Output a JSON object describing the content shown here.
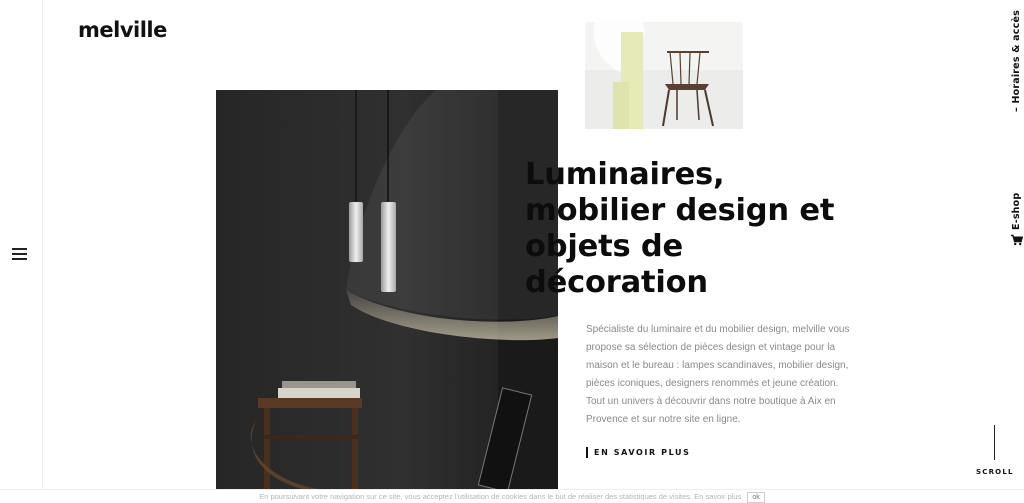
{
  "brand": {
    "logo_text": "melville"
  },
  "nav": {
    "menu_icon": "hamburger-menu-icon"
  },
  "side_links": {
    "hours": "– Horaires & accès",
    "eshop": "E-shop",
    "eshop_icon": "shopping-cart-icon"
  },
  "hero": {
    "headline_lines": [
      "Luminaires,",
      "mobilier design et",
      "objets de",
      "décoration"
    ],
    "description": "Spécialiste du luminaire et du mobilier design, melville vous propose sa sélection de pièces design et vintage pour la maison et le bureau : lampes scandinaves, mobilier design, pièces iconiques, designers renommés et jeune création. Tout un univers à découvrir dans notre boutique à Aix en Provence et sur notre site en ligne.",
    "cta": "EN SAVOIR PLUS"
  },
  "scroll": {
    "label": "SCROLL"
  },
  "cookie": {
    "text": "En poursuivant votre navigation sur ce site, vous acceptez l'utilisation de cookies dans le but de réaliser des statistiques de visites.",
    "link": "En savoir plus",
    "ok": "ok"
  },
  "colors": {
    "text_dark": "#0c0c0c",
    "text_muted": "#8a8a8a",
    "lampshade_yellow": "#e8ecb4",
    "background": "#ffffff"
  }
}
